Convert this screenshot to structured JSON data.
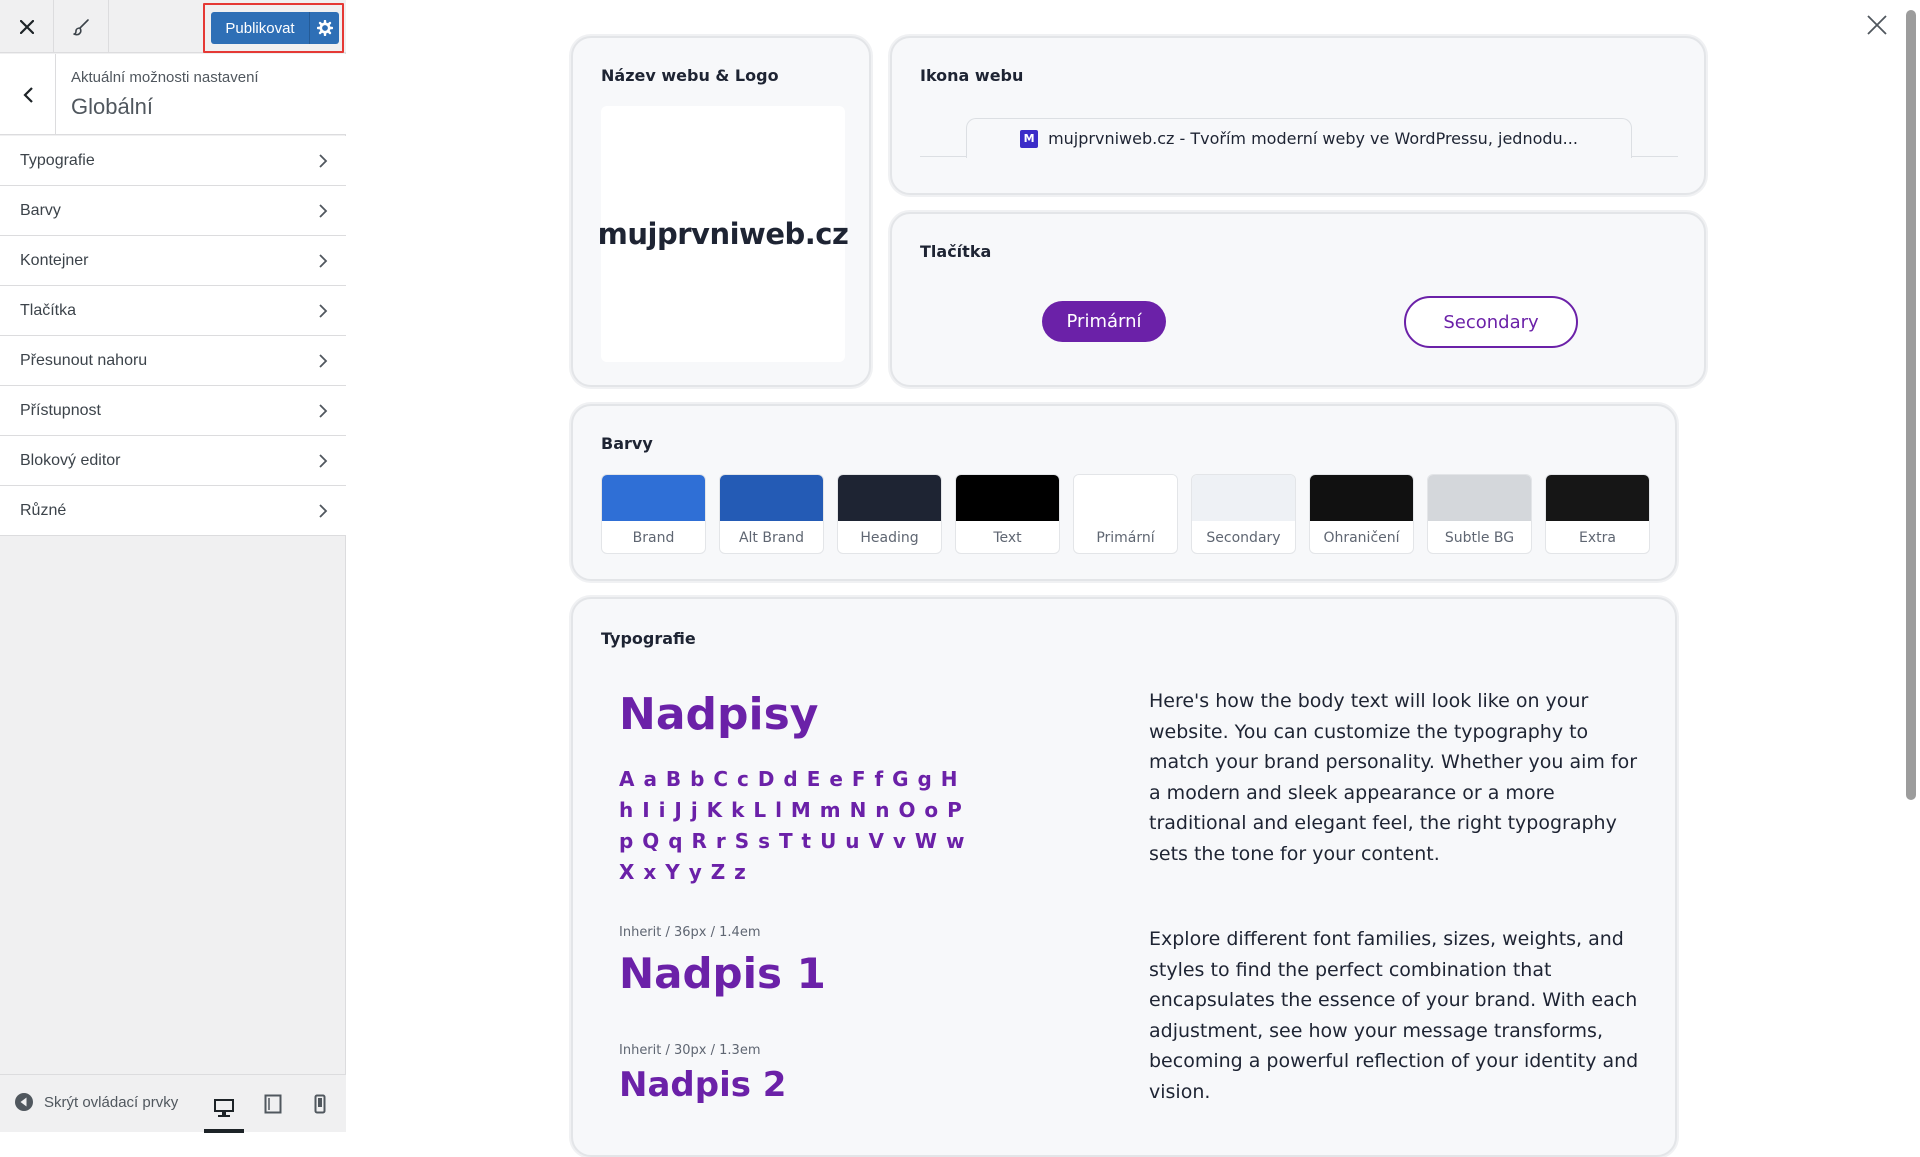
{
  "sidebar": {
    "publish_label": "Publikovat",
    "section_caption": "Aktuální možnosti nastavení",
    "section_title": "Globální",
    "menu": [
      {
        "label": "Typografie"
      },
      {
        "label": "Barvy"
      },
      {
        "label": "Kontejner"
      },
      {
        "label": "Tlačítka"
      },
      {
        "label": "Přesunout nahoru"
      },
      {
        "label": "Přístupnost"
      },
      {
        "label": "Blokový editor"
      },
      {
        "label": "Různé"
      }
    ],
    "footer": {
      "hide_controls_label": "Skrýt ovládací prvky",
      "active_device": "desktop"
    }
  },
  "preview": {
    "logo_card": {
      "title": "Název webu & Logo",
      "site_name": "mujprvniweb.cz"
    },
    "icon_card": {
      "title": "Ikona webu",
      "favicon_letter": "M",
      "tab_title": "mujprvniweb.cz - Tvořím moderní weby ve WordPressu, jednodu..."
    },
    "buttons_card": {
      "title": "Tlačítka",
      "primary_label": "Primární",
      "secondary_label": "Secondary"
    },
    "colors_card": {
      "title": "Barvy",
      "swatches": [
        {
          "label": "Brand",
          "color": "#2f6fd6"
        },
        {
          "label": "Alt Brand",
          "color": "#245bb5"
        },
        {
          "label": "Heading",
          "color": "#1e2433"
        },
        {
          "label": "Text",
          "color": "#000000"
        },
        {
          "label": "Primární",
          "color": "#ffffff"
        },
        {
          "label": "Secondary",
          "color": "#eef1f5"
        },
        {
          "label": "Ohraničení",
          "color": "#111111"
        },
        {
          "label": "Subtle BG",
          "color": "#d4d7db"
        },
        {
          "label": "Extra",
          "color": "#161616"
        }
      ]
    },
    "typography_card": {
      "title": "Typografie",
      "heading_sample": "Nadpisy",
      "alphabet": "A a B b C c D d E e F f G g H h I i J j K k L l M m N n O o P p Q q R r S s T t U u V v W w X x Y y Z z",
      "h1_spec": "Inherit / 36px / 1.4em",
      "h1_sample": "Nadpis 1",
      "h2_spec": "Inherit / 30px / 1.3em",
      "h2_sample": "Nadpis 2",
      "body_paragraph_1": "Here's how the body text will look like on your website. You can customize the typography to match your brand personality. Whether you aim for a modern and sleek appearance or a more traditional and elegant feel, the right typography sets the tone for your content.",
      "body_paragraph_2": "Explore different font families, sizes, weights, and styles to find the perfect combination that encapsulates the essence of your brand. With each adjustment, see how your message transforms, becoming a powerful reflection of your identity and vision."
    },
    "colors": {
      "accent": "#6b21a8",
      "publish_blue": "#2e6fb6"
    }
  }
}
